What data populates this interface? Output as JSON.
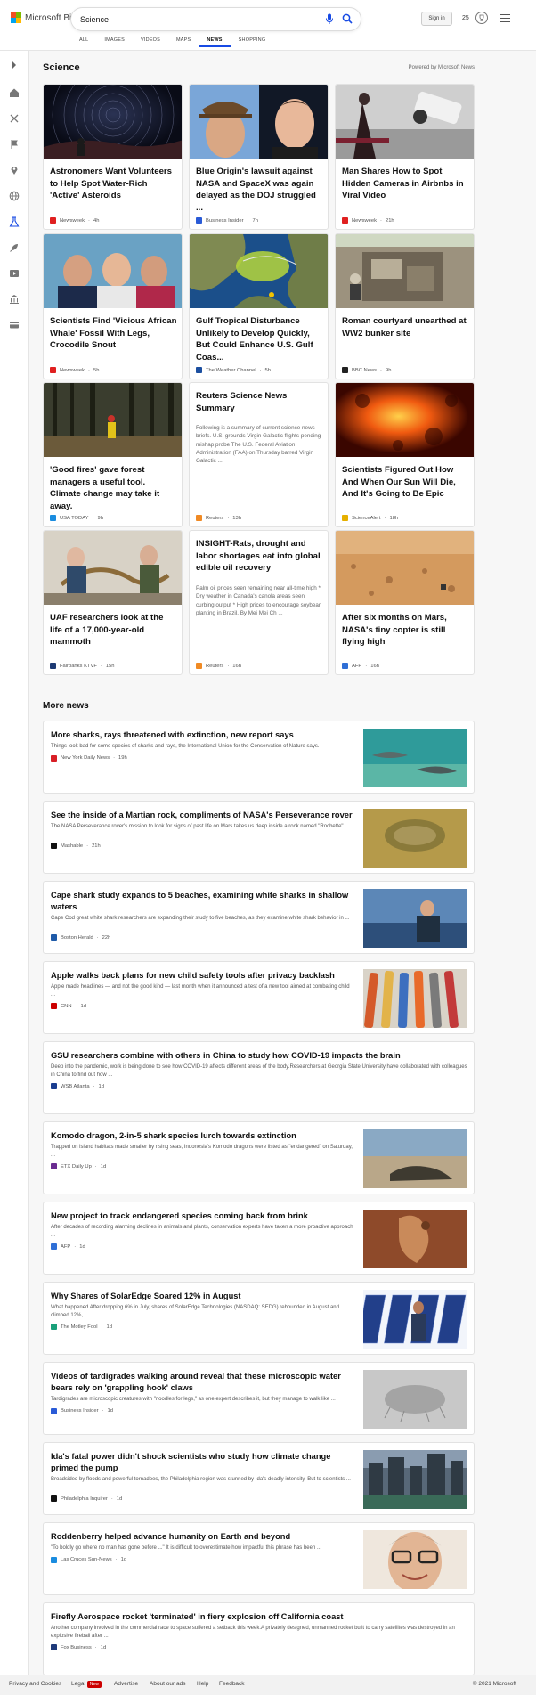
{
  "brand": {
    "logo_text": "Microsoft Bing",
    "colors": [
      "#f25022",
      "#7fba00",
      "#00a4ef",
      "#ffb900"
    ]
  },
  "search": {
    "value": "Science",
    "mic_icon": "mic-icon",
    "search_icon": "search-icon"
  },
  "account": {
    "signin_label": "Sign in",
    "points": "25"
  },
  "scopes": [
    {
      "label": "ALL"
    },
    {
      "label": "IMAGES"
    },
    {
      "label": "VIDEOS"
    },
    {
      "label": "MAPS"
    },
    {
      "label": "NEWS"
    },
    {
      "label": "SHOPPING"
    }
  ],
  "scopes_active": "NEWS",
  "accent": "#174ae4",
  "main": {
    "section_title": "Science",
    "powered_by": "Powered by Microsoft News"
  },
  "cards": [
    {
      "title": "Astronomers Want Volunteers to Help Spot Water-Rich 'Active' Asteroids",
      "source": "Newsweek",
      "time": "4h",
      "icon_color": "#e02020"
    },
    {
      "title": "Blue Origin's lawsuit against NASA and SpaceX was again delayed as the DOJ struggled ...",
      "source": "Business Insider",
      "time": "7h",
      "icon_color": "#2a5bd7"
    },
    {
      "title": "Man Shares How to Spot Hidden Cameras in Airbnbs in Viral Video",
      "source": "Newsweek",
      "time": "21h",
      "icon_color": "#e02020"
    },
    {
      "title": "Scientists Find 'Vicious African Whale' Fossil With Legs, Crocodile Snout",
      "source": "Newsweek",
      "time": "5h",
      "icon_color": "#e02020"
    },
    {
      "title": "Gulf Tropical Disturbance Unlikely to Develop Quickly, But Could Enhance U.S. Gulf Coas...",
      "source": "The Weather Channel",
      "time": "5h",
      "icon_color": "#1c4fa0"
    },
    {
      "title": "Roman courtyard unearthed at WW2 bunker site",
      "source": "BBC News",
      "time": "9h",
      "icon_color": "#222222"
    },
    {
      "title": "'Good fires' gave forest managers a useful tool. Climate change may take it away.",
      "source": "USA TODAY",
      "time": "9h",
      "icon_color": "#1a8cdf"
    },
    {
      "title": "Reuters Science News Summary",
      "snippet": "Following is a summary of current science news briefs. U.S. grounds Virgin Galactic flights pending mishap probe The U.S. Federal Aviation Administration (FAA) on Thursday barred Virgin Galactic ...",
      "source": "Reuters",
      "time": "13h",
      "icon_color": "#f08a24"
    },
    {
      "title": "Scientists Figured Out How And When Our Sun Will Die, And It's Going to Be Epic",
      "source": "ScienceAlert",
      "time": "18h",
      "icon_color": "#e6b000"
    },
    {
      "title": "UAF researchers look at the life of a 17,000-year-old mammoth",
      "source": "Fairbanks KTVF",
      "time": "15h",
      "icon_color": "#1d3a73"
    },
    {
      "title": "INSIGHT-Rats, drought and labor shortages eat into global edible oil recovery",
      "snippet": "Palm oil prices seen remaining near all-time high * Dry weather in Canada's canola areas seen curbing output * High prices to encourage soybean planting in Brazil. By Mei Mei Ch ...",
      "source": "Reuters",
      "time": "16h",
      "icon_color": "#f08a24"
    },
    {
      "title": "After six months on Mars, NASA's tiny copter is still flying high",
      "source": "AFP",
      "time": "16h",
      "icon_color": "#2f6fd6"
    }
  ],
  "more_news": {
    "title": "More news",
    "items": [
      {
        "title": "More sharks, rays threatened with extinction, new report says",
        "snippet": "Things look bad for some species of sharks and rays, the International Union for the Conservation of Nature says.",
        "source": "New York Daily News",
        "time": "19h",
        "icon_color": "#d81f26"
      },
      {
        "title": "See the inside of a Martian rock, compliments of NASA's Perseverance rover",
        "snippet": "The NASA Perseverance rover's mission to look for signs of past life on Mars takes us deep inside a rock named \"Rochette\".",
        "source": "Mashable",
        "time": "21h",
        "icon_color": "#111111"
      },
      {
        "title": "Cape shark study expands to 5 beaches, examining white sharks in shallow waters",
        "snippet": "Cape Cod great white shark researchers are expanding their study to five beaches, as they examine white shark behavior in ...",
        "source": "Boston Herald",
        "time": "22h",
        "icon_color": "#1e5aa8"
      },
      {
        "title": "Apple walks back plans for new child safety tools after privacy backlash",
        "snippet": "Apple made headlines — and not the good kind — last month when it announced a test of a new tool aimed at combating child ...",
        "source": "CNN",
        "time": "1d",
        "icon_color": "#cc0000"
      },
      {
        "title": "GSU researchers combine with others in China to study how COVID-19 impacts the brain",
        "snippet": "Deep into the pandemic, work is being done to see how COVID-19 affects different areas of the body.Researchers at Georgia State University have collaborated with colleagues in China to find out how ...",
        "source": "WSB Atlanta",
        "time": "1d",
        "icon_color": "#1a3d8f"
      },
      {
        "title": "Komodo dragon, 2-in-5 shark species lurch towards extinction",
        "snippet": "Trapped on island habitats made smaller by rising seas, Indonesia's Komodo dragons were listed as \"endangered\" on Saturday, ...",
        "source": "ETX Daily Up",
        "time": "1d",
        "icon_color": "#6a2c91"
      },
      {
        "title": "New project to track endangered species coming back from brink",
        "snippet": "After decades of recording alarming declines in animals and plants, conservation experts have taken a more proactive approach ...",
        "source": "AFP",
        "time": "1d",
        "icon_color": "#2f6fd6"
      },
      {
        "title": "Why Shares of SolarEdge Soared 12% in August",
        "snippet": "What happened After dropping 6% in July, shares of SolarEdge Technologies (NASDAQ: SEDG) rebounded in August and climbed 12%, ...",
        "source": "The Motley Fool",
        "time": "1d",
        "icon_color": "#1aa07a"
      },
      {
        "title": "Videos of tardigrades walking around reveal that these microscopic water bears rely on 'grappling hook' claws",
        "snippet": "Tardigrades are microscopic creatures with \"noodles for legs,\" as one expert describes it, but they manage to walk like ...",
        "source": "Business Insider",
        "time": "1d",
        "icon_color": "#2a5bd7"
      },
      {
        "title": "Ida's fatal power didn't shock scientists who study how climate change primed the pump",
        "snippet": "Broadsided by floods and powerful tornadoes, the Philadelphia region was stunned by Ida's deadly intensity. But to scientists ...",
        "source": "Philadelphia Inquirer",
        "time": "1d",
        "icon_color": "#111111"
      },
      {
        "title": "Roddenberry helped advance humanity on Earth and beyond",
        "snippet": "\"To boldly go where no man has gone before ...\" It is difficult to overestimate how impactful this phrase has been ...",
        "source": "Las Cruces Sun-News",
        "time": "1d",
        "icon_color": "#1a8cdf"
      },
      {
        "title": "Firefly Aerospace rocket 'terminated' in fiery explosion off California coast",
        "snippet": "Another company involved in the commercial race to space suffered a setback this week.A privately designed, unmanned rocket built to carry satellites was destroyed in an explosive fireball after ...",
        "source": "Fox Business",
        "time": "1d",
        "icon_color": "#1e3a7a"
      }
    ]
  },
  "footer": {
    "links": [
      "Privacy and Cookies",
      "Legal",
      "Advertise",
      "About our ads",
      "Help",
      "Feedback"
    ],
    "new_badge": "New",
    "copyright": "© 2021 Microsoft"
  }
}
